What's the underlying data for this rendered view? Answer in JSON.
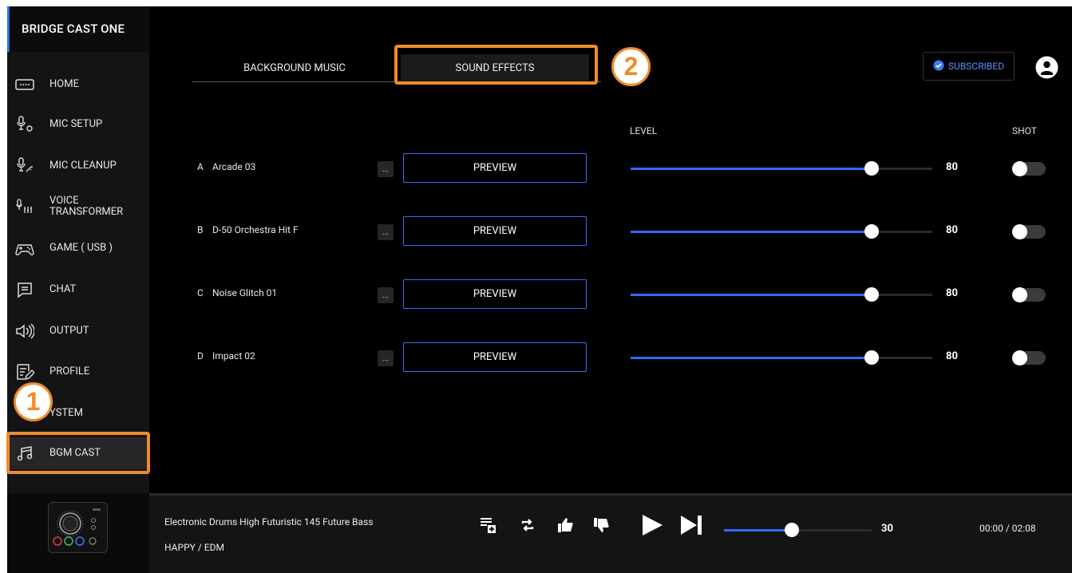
{
  "app": {
    "title": "BRIDGE CAST ONE"
  },
  "sidebar": {
    "items": [
      {
        "label": "HOME",
        "icon": "keyboard-icon"
      },
      {
        "label": "MIC SETUP",
        "icon": "mic-gear-icon"
      },
      {
        "label": "MIC CLEANUP",
        "icon": "mic-sparkle-icon"
      },
      {
        "label": "VOICE TRANSFORMER",
        "icon": "mic-sliders-icon"
      },
      {
        "label": "GAME ( USB )",
        "icon": "gamepad-icon"
      },
      {
        "label": "CHAT",
        "icon": "chat-icon"
      },
      {
        "label": "OUTPUT",
        "icon": "speaker-icon"
      },
      {
        "label": "PROFILE",
        "icon": "profile-edit-icon"
      },
      {
        "label": "YSTEM",
        "icon": "gear-icon"
      },
      {
        "label": "BGM CAST",
        "icon": "music-note-icon"
      }
    ],
    "active": "BGM CAST"
  },
  "tabs": [
    {
      "label": "BACKGROUND MUSIC"
    },
    {
      "label": "SOUND EFFECTS"
    }
  ],
  "subscription": {
    "label": "SUBSCRIBED",
    "color": "#5a90ff"
  },
  "columns": {
    "level": "LEVEL",
    "shot": "SHOT"
  },
  "effects": [
    {
      "letter": "A",
      "name": "Arcade 03",
      "more": "...",
      "preview": "PREVIEW",
      "level": 80,
      "level_text": "80",
      "shot": false
    },
    {
      "letter": "B",
      "name": "D-50 Orchestra Hit F",
      "more": "...",
      "preview": "PREVIEW",
      "level": 80,
      "level_text": "80",
      "shot": false
    },
    {
      "letter": "C",
      "name": "Noise Glitch 01",
      "more": "...",
      "preview": "PREVIEW",
      "level": 80,
      "level_text": "80",
      "shot": false
    },
    {
      "letter": "D",
      "name": "Impact 02",
      "more": "...",
      "preview": "PREVIEW",
      "level": 80,
      "level_text": "80",
      "shot": false
    }
  ],
  "player": {
    "title": "Electronic Drums High Futuristic 145 Future Bass",
    "genre": "HAPPY / EDM",
    "volume": 30,
    "volume_text": "30",
    "time": "00:00 / 02:08"
  },
  "annotations": [
    {
      "number": "1",
      "target": "BGM CAST"
    },
    {
      "number": "2",
      "target": "SOUND EFFECTS"
    }
  ],
  "colors": {
    "accent": "#2f6cff",
    "highlight": "#ef8c2a",
    "background": "#000000"
  }
}
